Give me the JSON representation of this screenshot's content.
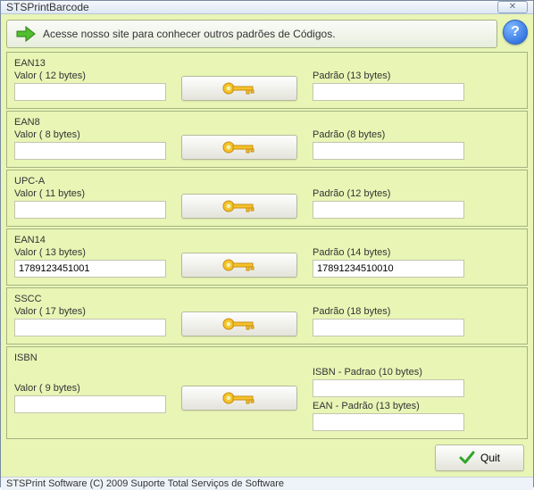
{
  "window": {
    "title": "STSPrintBarcode"
  },
  "banner": {
    "text": "Acesse nosso site para conhecer outros padrões de Códigos."
  },
  "groups": {
    "ean13": {
      "title": "EAN13",
      "valor_label": "Valor ( 12  bytes)",
      "valor": "",
      "padrao_label": "Padrão (13  bytes)",
      "padrao": ""
    },
    "ean8": {
      "title": "EAN8",
      "valor_label": "Valor ( 8  bytes)",
      "valor": "",
      "padrao_label": "Padrão (8  bytes)",
      "padrao": ""
    },
    "upca": {
      "title": "UPC-A",
      "valor_label": "Valor ( 11  bytes)",
      "valor": "",
      "padrao_label": "Padrão (12  bytes)",
      "padrao": ""
    },
    "ean14": {
      "title": "EAN14",
      "valor_label": "Valor ( 13  bytes)",
      "valor": "1789123451001",
      "padrao_label": "Padrão (14  bytes)",
      "padrao": "17891234510010"
    },
    "sscc": {
      "title": "SSCC",
      "valor_label": "Valor ( 17  bytes)",
      "valor": "",
      "padrao_label": "Padrão (18  bytes)",
      "padrao": ""
    },
    "isbn": {
      "title": "ISBN",
      "valor_label": "Valor ( 9  bytes)",
      "valor": "",
      "isbn_padrao_label": "ISBN - Padrao (10  bytes)",
      "isbn_padrao": "",
      "ean_padrao_label": "EAN - Padrão (13  bytes)",
      "ean_padrao": ""
    }
  },
  "buttons": {
    "quit": "Quit"
  },
  "status": "STSPrint Software (C) 2009 Suporte Total Serviços de Software"
}
